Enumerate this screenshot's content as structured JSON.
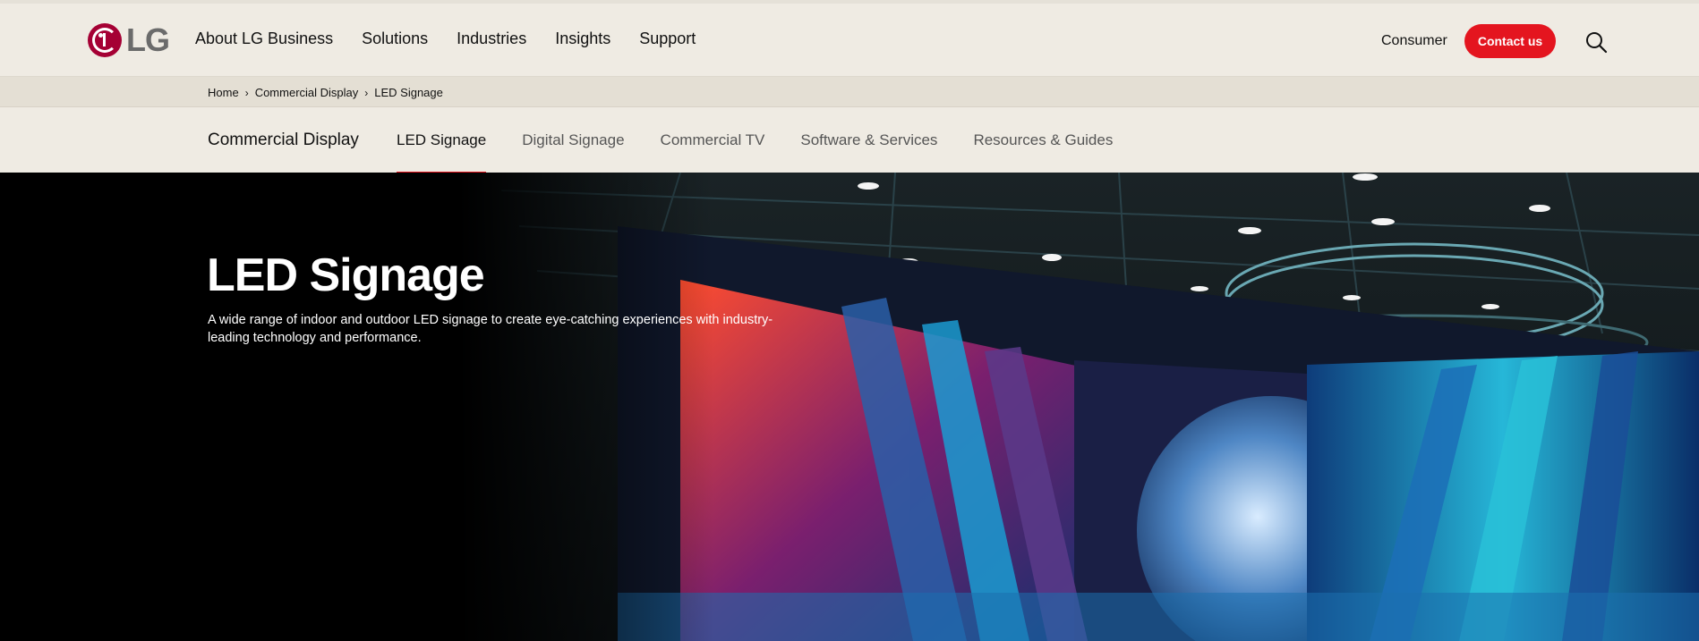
{
  "brand": {
    "logo_text": "LG",
    "accent": "#a50034",
    "cta_color": "#e4151f"
  },
  "header": {
    "nav": [
      "About LG Business",
      "Solutions",
      "Industries",
      "Insights",
      "Support"
    ],
    "consumer_label": "Consumer",
    "contact_label": "Contact us",
    "search_icon": "search-icon"
  },
  "breadcrumb": {
    "items": [
      "Home",
      "Commercial Display",
      "LED Signage"
    ]
  },
  "subnav": {
    "title": "Commercial Display",
    "items": [
      "LED Signage",
      "Digital Signage",
      "Commercial TV",
      "Software & Services",
      "Resources & Guides"
    ],
    "active": "LED Signage"
  },
  "hero": {
    "title": "LED Signage",
    "description": "A wide range of indoor and outdoor LED signage to create eye-catching experiences with industry-leading technology and performance."
  }
}
